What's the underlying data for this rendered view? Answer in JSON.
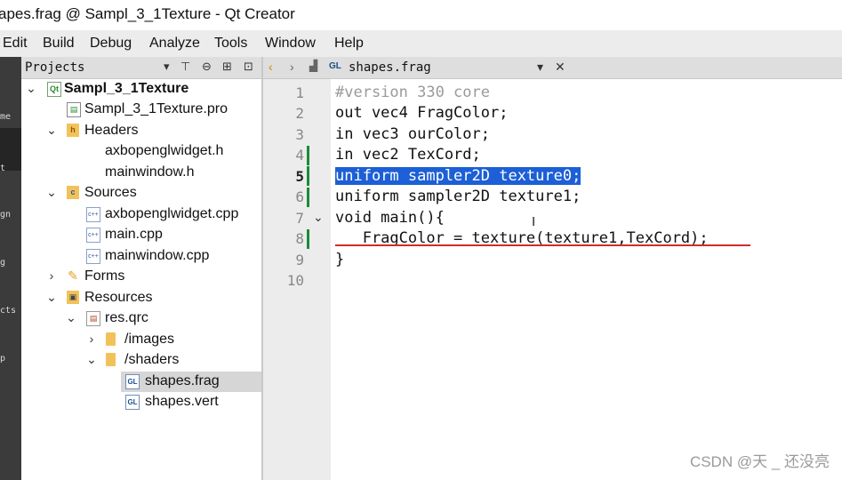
{
  "window": {
    "title": "apes.frag @ Sampl_3_1Texture - Qt Creator"
  },
  "menu": [
    "Edit",
    "Build",
    "Debug",
    "Analyze",
    "Tools",
    "Window",
    "Help"
  ],
  "mode_strip": [
    "me",
    "t",
    "gn",
    "g",
    "cts",
    "p"
  ],
  "projects_panel": {
    "title": "Projects"
  },
  "tree": [
    {
      "label": "Sampl_3_1Texture",
      "icon": "qt-project-icon",
      "expanded": true
    },
    {
      "label": "Sampl_3_1Texture.pro",
      "icon": "pro-file-icon"
    },
    {
      "label": "Headers",
      "icon": "headers-folder-icon",
      "expanded": true
    },
    {
      "label": "axbopenglwidget.h",
      "icon": "header-file-icon"
    },
    {
      "label": "mainwindow.h",
      "icon": "header-file-icon"
    },
    {
      "label": "Sources",
      "icon": "sources-folder-icon",
      "expanded": true
    },
    {
      "label": "axbopenglwidget.cpp",
      "icon": "cpp-file-icon"
    },
    {
      "label": "main.cpp",
      "icon": "cpp-file-icon"
    },
    {
      "label": "mainwindow.cpp",
      "icon": "cpp-file-icon"
    },
    {
      "label": "Forms",
      "icon": "forms-folder-icon",
      "expanded": false
    },
    {
      "label": "Resources",
      "icon": "resources-folder-icon",
      "expanded": true
    },
    {
      "label": "res.qrc",
      "icon": "qrc-file-icon",
      "expanded": true
    },
    {
      "label": "/images",
      "icon": "folder-icon",
      "expanded": false
    },
    {
      "label": "/shaders",
      "icon": "folder-icon",
      "expanded": true
    },
    {
      "label": "shapes.frag",
      "icon": "gl-file-icon",
      "selected": true
    },
    {
      "label": "shapes.vert",
      "icon": "gl-file-icon"
    }
  ],
  "editor": {
    "file_name": "shapes.frag",
    "current_line": "5",
    "line_numbers": [
      "1",
      "2",
      "3",
      "4",
      "5",
      "6",
      "7",
      "8",
      "9",
      "10"
    ],
    "lines": [
      "#version 330 core",
      "out vec4 FragColor;",
      "in vec3 ourColor;",
      "in vec2 TexCord;",
      "uniform sampler2D texture0;",
      "uniform sampler2D texture1;",
      "void main(){",
      "   FragColor = texture(texture1,TexCord);",
      "}",
      ""
    ]
  },
  "watermark": "CSDN @天 _ 还没亮",
  "colors": {
    "selection": "#1c5fd6",
    "keyword": "#7a7a00",
    "change_marker": "#1d8a3a",
    "error_underline": "#cf2c2c"
  }
}
